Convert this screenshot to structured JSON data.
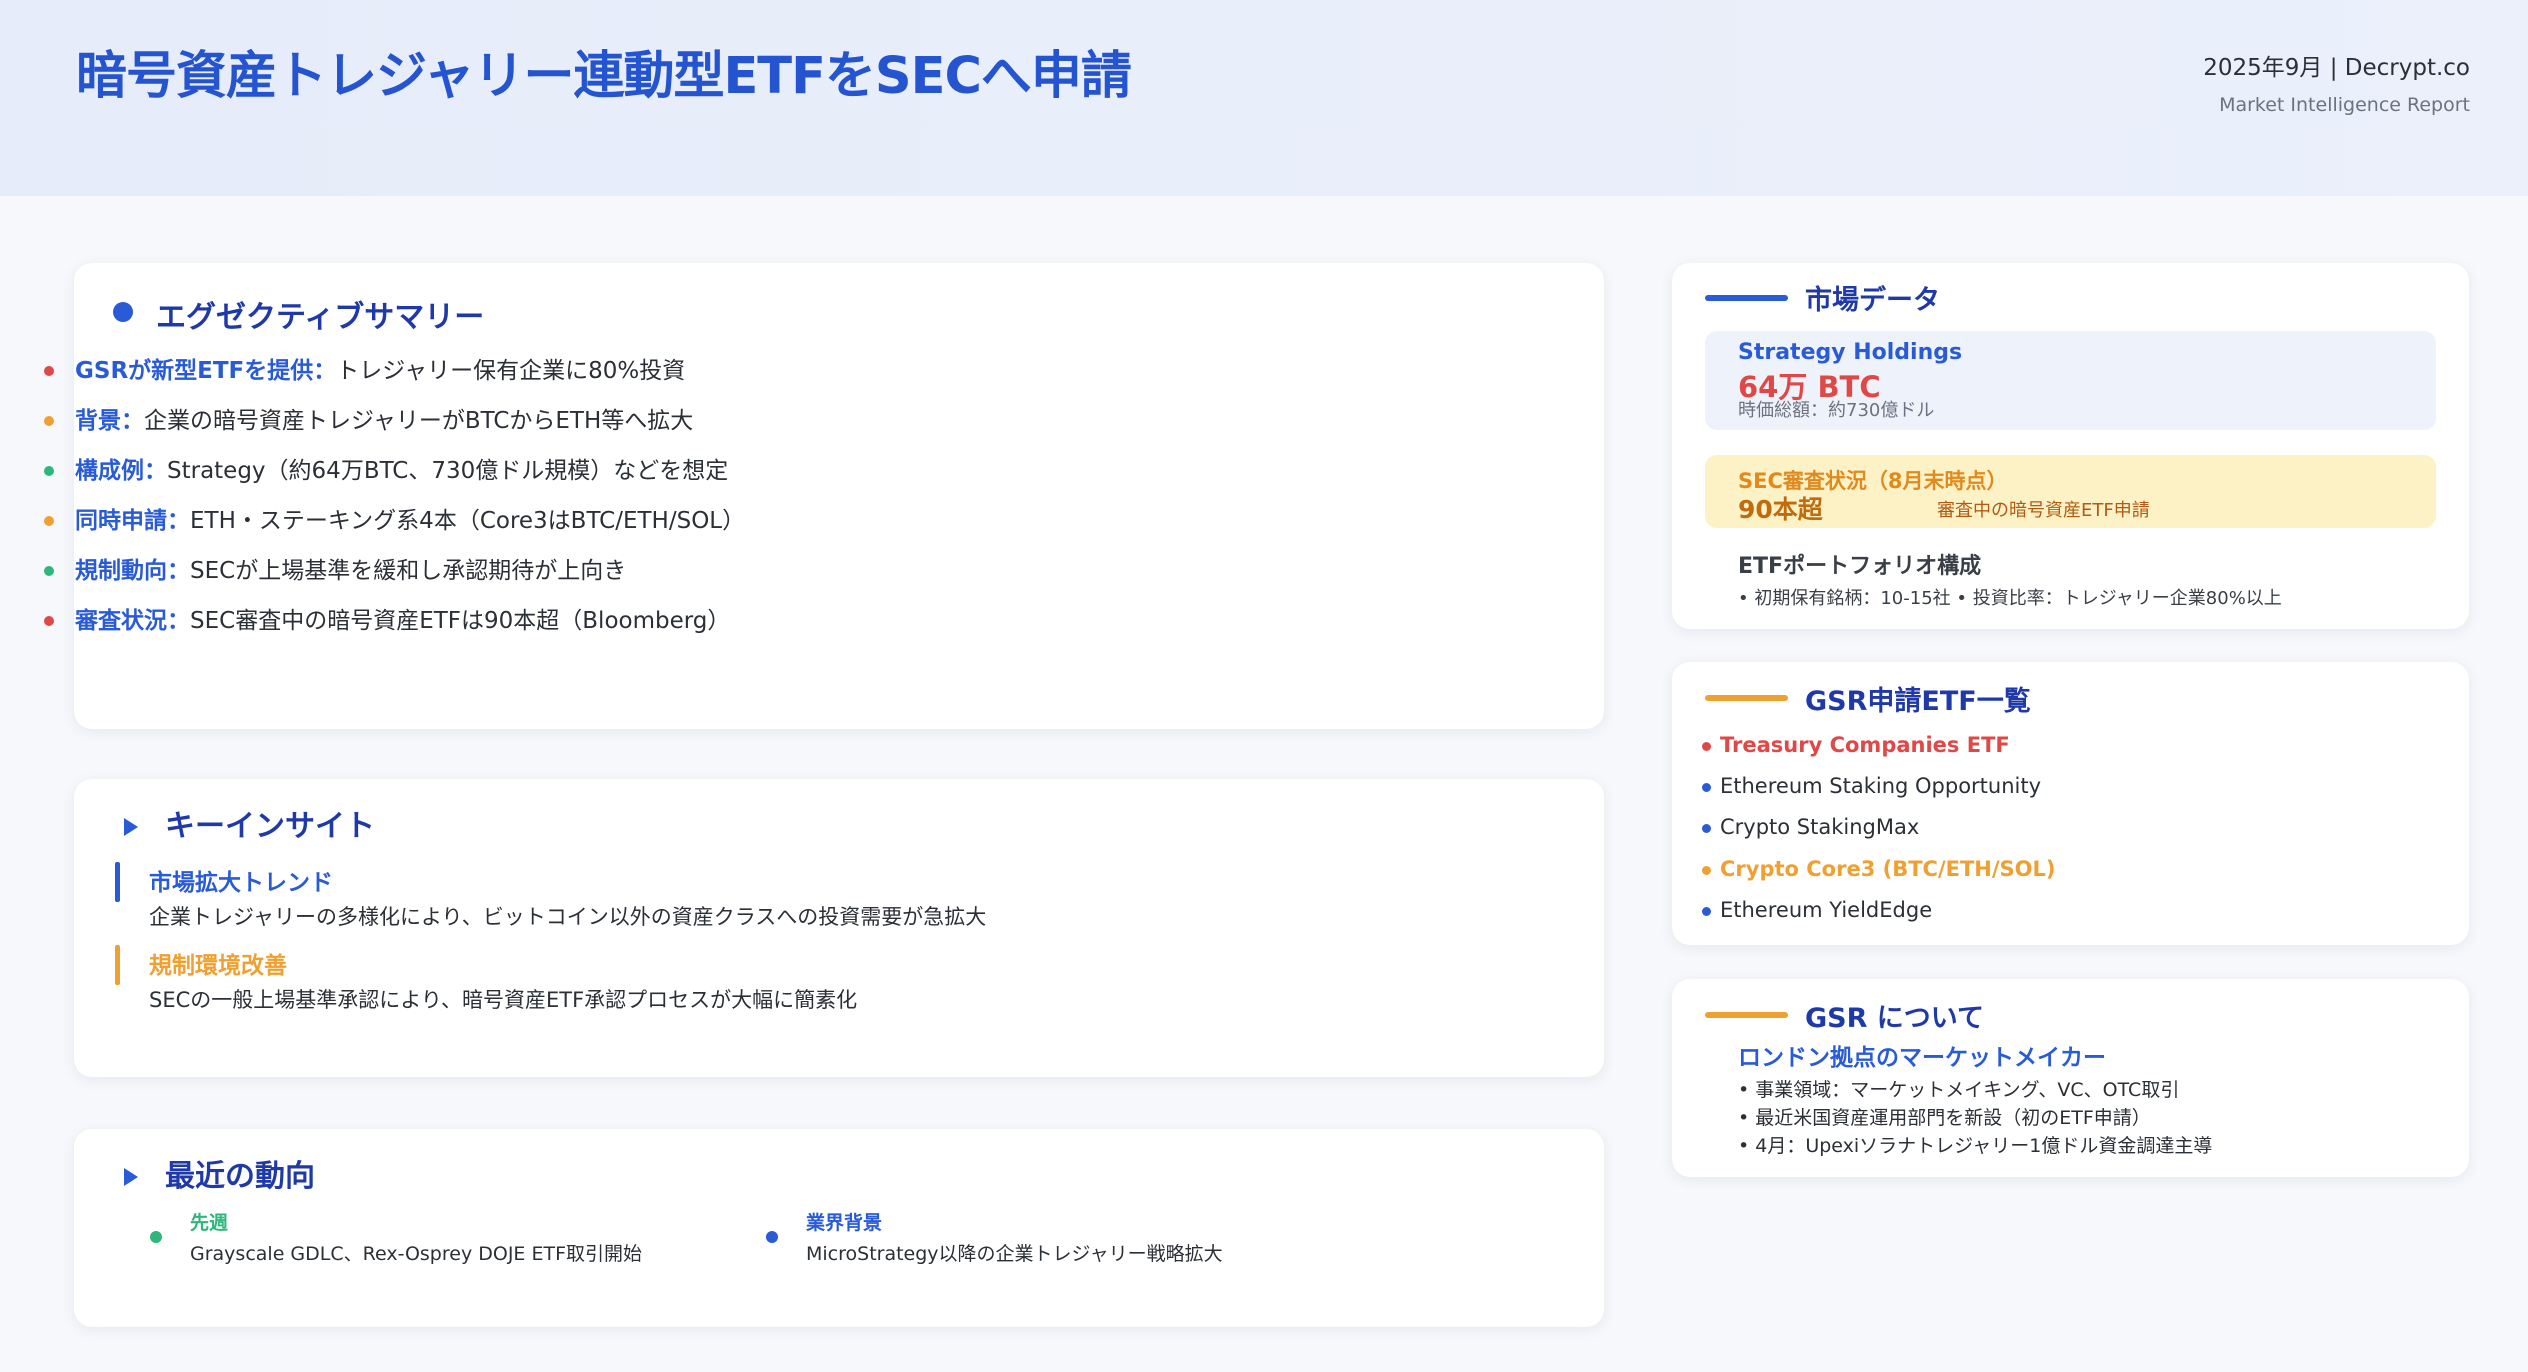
{
  "header": {
    "title": "暗号資産トレジャリー連動型ETFをSECへ申請",
    "date_source": "2025年9月 | Decrypt.co",
    "subtitle": "Market Intelligence Report"
  },
  "summary": {
    "title": "エグゼクティブサマリー",
    "items": [
      {
        "key": "GSRが新型ETFを提供：",
        "text": "トレジャリー保有企業に80%投資",
        "color": "#e04848"
      },
      {
        "key": "背景：",
        "text": "企業の暗号資産トレジャリーがBTCからETH等へ拡大",
        "color": "#f0a030"
      },
      {
        "key": "構成例：",
        "text": "Strategy（約64万BTC、730億ドル規模）などを想定",
        "color": "#2fb67a"
      },
      {
        "key": "同時申請：",
        "text": "ETH・ステーキング系4本（Core3はBTC/ETH/SOL）",
        "color": "#f0a030"
      },
      {
        "key": "規制動向：",
        "text": "SECが上場基準を緩和し承認期待が上向き",
        "color": "#2fb67a"
      },
      {
        "key": "審査状況：",
        "text": "SEC審査中の暗号資産ETFは90本超（Bloomberg）",
        "color": "#e04848"
      }
    ]
  },
  "insights": {
    "title": "キーインサイト",
    "items": [
      {
        "head": "市場拡大トレンド",
        "body": "企業トレジャリーの多様化により、ビットコイン以外の資産クラスへの投資需要が急拡大",
        "color": "#2a5bd7"
      },
      {
        "head": "規制環境改善",
        "body": "SECの一般上場基準承認により、暗号資産ETF承認プロセスが大幅に簡素化",
        "color": "#f0a030"
      }
    ]
  },
  "recent": {
    "title": "最近の動向",
    "items": [
      {
        "head": "先週",
        "body": "Grayscale GDLC、Rex-Osprey DOJE ETF取引開始",
        "color": "#2fb67a"
      },
      {
        "head": "業界背景",
        "body": "MicroStrategy以降の企業トレジャリー戦略拡大",
        "color": "#2a5bd7"
      }
    ]
  },
  "market": {
    "title": "市場データ",
    "strategy_label": "Strategy Holdings",
    "strategy_value": "64万 BTC",
    "strategy_note": "時価総額：約730億ドル",
    "sec_label": "SEC審査状況（8月末時点）",
    "sec_value": "90本超",
    "sec_note": "審査中の暗号資産ETF申請",
    "portfolio_title": "ETFポートフォリオ構成",
    "portfolio_note": "• 初期保有銘柄：10-15社 • 投資比率：トレジャリー企業80%以上"
  },
  "etf_list": {
    "title": "GSR申請ETF一覧",
    "items": [
      {
        "label": "Treasury Companies ETF",
        "color": "#e04848",
        "text_color": "#e04848",
        "bold": true
      },
      {
        "label": "Ethereum Staking Opportunity",
        "color": "#2a5bd7",
        "text_color": "#2b2f36",
        "bold": false
      },
      {
        "label": "Crypto StakingMax",
        "color": "#2a5bd7",
        "text_color": "#2b2f36",
        "bold": false
      },
      {
        "label": "Crypto Core3 (BTC/ETH/SOL)",
        "color": "#f0a030",
        "text_color": "#f0a030",
        "bold": true
      },
      {
        "label": "Ethereum YieldEdge",
        "color": "#2a5bd7",
        "text_color": "#2b2f36",
        "bold": false
      }
    ]
  },
  "about": {
    "title": "GSR について",
    "subtitle": "ロンドン拠点のマーケットメイカー",
    "lines": [
      "• 事業領域：マーケットメイキング、VC、OTC取引",
      "• 最近米国資産運用部門を新設（初のETF申請）",
      "• 4月：Upexiソラナトレジャリー1億ドル資金調達主導"
    ]
  },
  "colors": {
    "brand_blue": "#2554d1",
    "accent_orange": "#f0a030",
    "accent_red": "#e04848",
    "accent_green": "#2fb67a"
  }
}
